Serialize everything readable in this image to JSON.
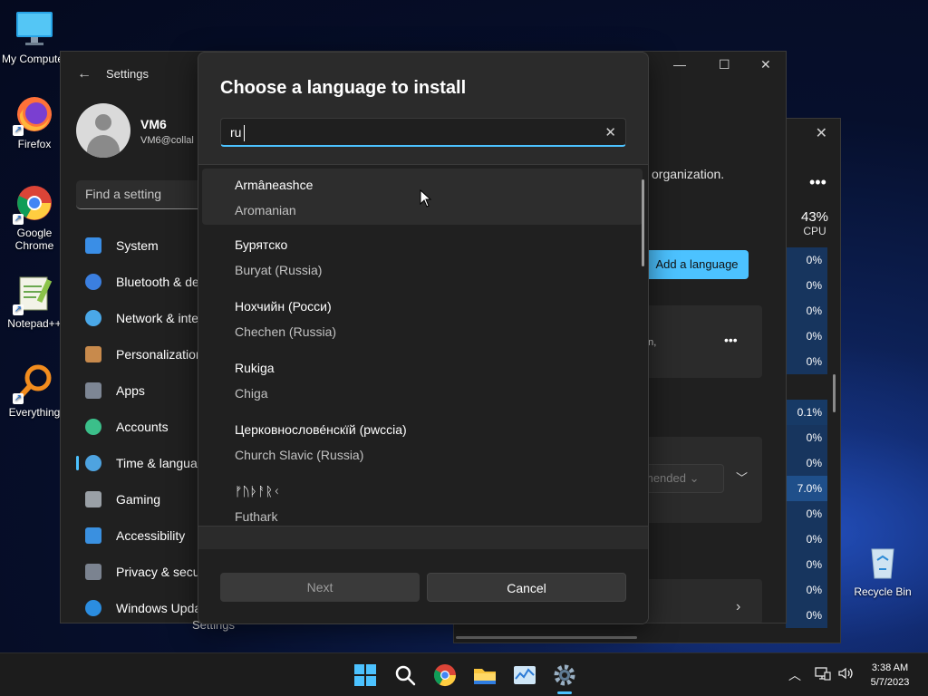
{
  "desktop": {
    "icons": [
      {
        "label": "My Computer"
      },
      {
        "label": "Firefox"
      },
      {
        "label": "Google Chrome"
      },
      {
        "label": "Notepad++"
      },
      {
        "label": "Everything"
      },
      {
        "label": "Recycle Bin"
      }
    ]
  },
  "task_manager": {
    "cpu_percent": "43%",
    "cpu_label": "CPU",
    "cpu_values": [
      "0%",
      "0%",
      "0%",
      "0%",
      "0%",
      "",
      "0.1%",
      "0%",
      "0%",
      "7.0%",
      "0%",
      "0%",
      "0%",
      "0%",
      "0%"
    ]
  },
  "settings": {
    "title": "Settings",
    "user_name": "VM6",
    "user_email": "VM6@collal",
    "search_placeholder": "Find a setting",
    "nav": [
      {
        "label": "System",
        "color": "#3a8ee6"
      },
      {
        "label": "Bluetooth & de",
        "color": "#3b7fe0"
      },
      {
        "label": "Network & inte",
        "color": "#4aa8e8"
      },
      {
        "label": "Personalization",
        "color": "#c88a4c"
      },
      {
        "label": "Apps",
        "color": "#7d8694"
      },
      {
        "label": "Accounts",
        "color": "#3bbf8a"
      },
      {
        "label": "Time & languag",
        "color": "#4ea3e0"
      },
      {
        "label": "Gaming",
        "color": "#9aa0a6"
      },
      {
        "label": "Accessibility",
        "color": "#3a90e0"
      },
      {
        "label": "Privacy & secu",
        "color": "#7b8390"
      },
      {
        "label": "Windows Upda",
        "color": "#2b8de0"
      }
    ],
    "org_text": "organization.",
    "add_language_label": "Add a language",
    "card_text": "on,",
    "recommended_text": "mended",
    "behind_label": "Settings"
  },
  "dialog": {
    "title": "Choose a language to install",
    "search_value": "ru",
    "languages": [
      {
        "native": "Armâneashce",
        "english": "Aromanian"
      },
      {
        "native": "Бурятско",
        "english": "Buryat (Russia)"
      },
      {
        "native": "Нохчийн (Росси)",
        "english": "Chechen (Russia)"
      },
      {
        "native": "Rukiga",
        "english": "Chiga"
      },
      {
        "native": "Церковнослове́нскїй (рwссіа)",
        "english": "Church Slavic (Russia)"
      },
      {
        "native": "ᚠᚢᚦᚨᚱᚲ",
        "english": "Futhark"
      }
    ],
    "next_label": "Next",
    "cancel_label": "Cancel"
  },
  "taskbar": {
    "time": "3:38 AM",
    "date": "5/7/2023",
    "accent": "#4cc2ff"
  }
}
